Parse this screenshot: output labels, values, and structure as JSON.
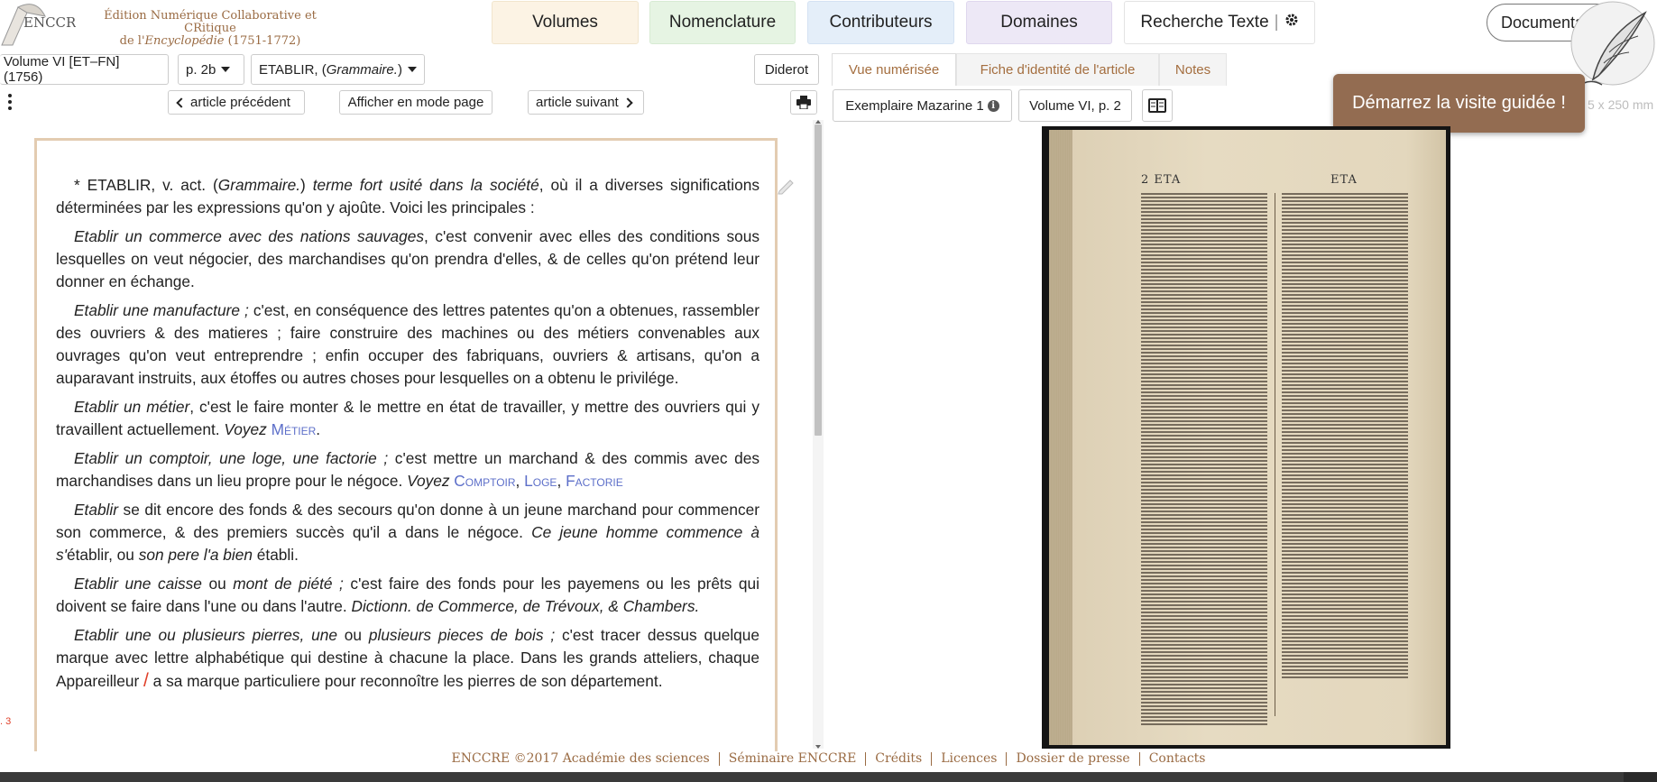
{
  "header": {
    "logo_text": "ENCCRE",
    "title_line1": "Édition Numérique Collaborative et CRitique",
    "title_line2_pre": "de l'",
    "title_line2_em": "Encyclopédie",
    "title_line2_post": " (1751-1772)",
    "nav": {
      "volumes": "Volumes",
      "nomenclature": "Nomenclature",
      "contributeurs": "Contributeurs",
      "domaines": "Domaines",
      "recherche": "Recherche Texte",
      "recherche_sep": "|"
    },
    "documentation": "Documentation"
  },
  "toolbar": {
    "volume": "Volume VI [ET–FN] (1756)",
    "page": "p. 2b",
    "article_name": "ETABLIR, (",
    "article_domain": "Grammaire.",
    "article_close": ")",
    "diderot": "Diderot",
    "tabs": [
      "Vue numérisée",
      "Fiche d'identité de l'article",
      "Notes"
    ]
  },
  "article_nav": {
    "previous": "article précédent",
    "page_mode": "Afficher en mode page",
    "next": "article suivant"
  },
  "viewer": {
    "exemplaire": "Exemplaire Mazarine 1",
    "info_glyph": "i",
    "volume_page": "Volume VI, p. 2",
    "dimensions": "5 x 250 mm",
    "tour": "Démarrez la visite guidée !",
    "scan_head_left": "2   ETA",
    "scan_head_right": "ETA"
  },
  "article": {
    "p1": {
      "a": "* ETABLIR, v. act. (",
      "b": "Grammaire.",
      "c": ") ",
      "d": "terme fort usité dans la société",
      "e": ", où il a diverses significations déterminées par les expressions qu'on y ajoûte. Voici les principales :"
    },
    "p2": {
      "a": "Etablir un commerce avec des nations sauvages",
      "b": ", c'est convenir avec elles des conditions sous lesquelles on veut négocier, des marchandises qu'on prendra d'elles, & de celles qu'on prétend leur donner en échange."
    },
    "p3": {
      "a": "Etablir une manufacture ;",
      "b": " c'est, en conséquence des lettres patentes qu'on a obtenues, rassembler des ouvriers & des matieres ; faire construire des machines ou des métiers convenables aux ouvrages qu'on veut entreprendre ; enfin occuper des fabriquans, ouvriers & artisans, qu'on a auparavant instruits, aux étoffes ou autres choses pour lesquelles on a obtenu le privilége."
    },
    "p4": {
      "a": "Etablir un métier",
      "b": ", c'est le faire monter & le mettre en état de travailler, y mettre des ouvriers qui y travaillent actuellement. ",
      "c": "Voyez",
      "d": " ",
      "e": "Métier",
      "f": "."
    },
    "p5": {
      "a": "Etablir un comptoir, une loge, une factorie ;",
      "b": " c'est mettre un marchand & des commis avec des marchandises dans un lieu propre pour le négoce. ",
      "c": "Voyez",
      "d": " ",
      "e": "Comptoir",
      "f": ", ",
      "g": "Loge",
      "h": ", ",
      "i": "Factorie"
    },
    "p6": {
      "a": "Etablir",
      "b": " se dit encore des fonds & des secours qu'on donne à un jeune marchand pour commencer son commerce, & des premiers succès qu'il a dans le négoce. ",
      "c": "Ce jeune homme commence à s'",
      "d": "établir, ou ",
      "e": "son pere l'a bien",
      "f": " établi."
    },
    "p7": {
      "a": "Etablir une caisse",
      "b": " ou ",
      "c": "mont de piété ;",
      "d": " c'est faire des fonds pour les payemens ou les prêts qui doivent se faire dans l'une ou dans l'autre. ",
      "e": "Dictionn. de Commerce, de Trévoux, & Chambers."
    },
    "p8": {
      "a": "Etablir une ou plusieurs pierres, une",
      "b": " ou ",
      "c": "plusieurs pieces de bois ;",
      "d": " c'est tracer dessus quelque marque avec lettre alphabétique qui destine à chacune la place. Dans les grands atteliers, chaque Appareilleur ",
      "e": "/",
      "f": " a sa marque particuliere pour reconnoître les pierres de son département."
    },
    "page_marker": ". 3"
  },
  "footer": {
    "links": [
      "ENCCRE ©2017 Académie des sciences",
      "Séminaire ENCCRE",
      "Crédits",
      "Licences",
      "Dossier de presse",
      "Contacts"
    ]
  },
  "colors": {
    "accent_brown": "#9a6b43",
    "tour_button": "#936c51",
    "xref_blue": "#5d6fc9",
    "frame_border": "#e3ccb1"
  }
}
